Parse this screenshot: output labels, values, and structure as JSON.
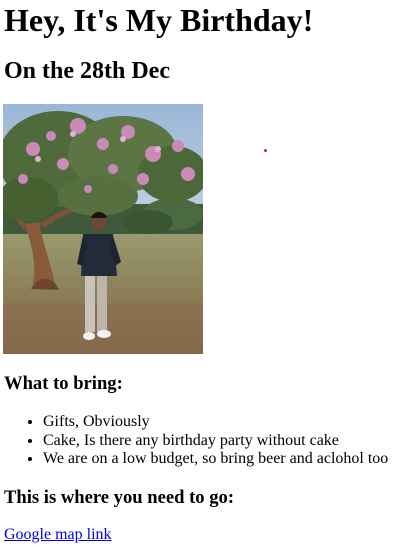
{
  "page": {
    "title": "Hey, It's My Birthday!",
    "subtitle": "On the 28th Dec"
  },
  "photo": {
    "alt": "Person standing in front of a flowering tree in a park"
  },
  "bring": {
    "heading": "What to bring:",
    "items": [
      "Gifts, Obviously",
      "Cake, Is there any birthday party without cake",
      "We are on a low budget, so bring beer and aclohol too"
    ]
  },
  "location": {
    "heading": "This is where you need to go:",
    "link_label": "Google map link"
  },
  "colors": {
    "link": "#0000ee",
    "text": "#000000",
    "background": "#ffffff"
  }
}
